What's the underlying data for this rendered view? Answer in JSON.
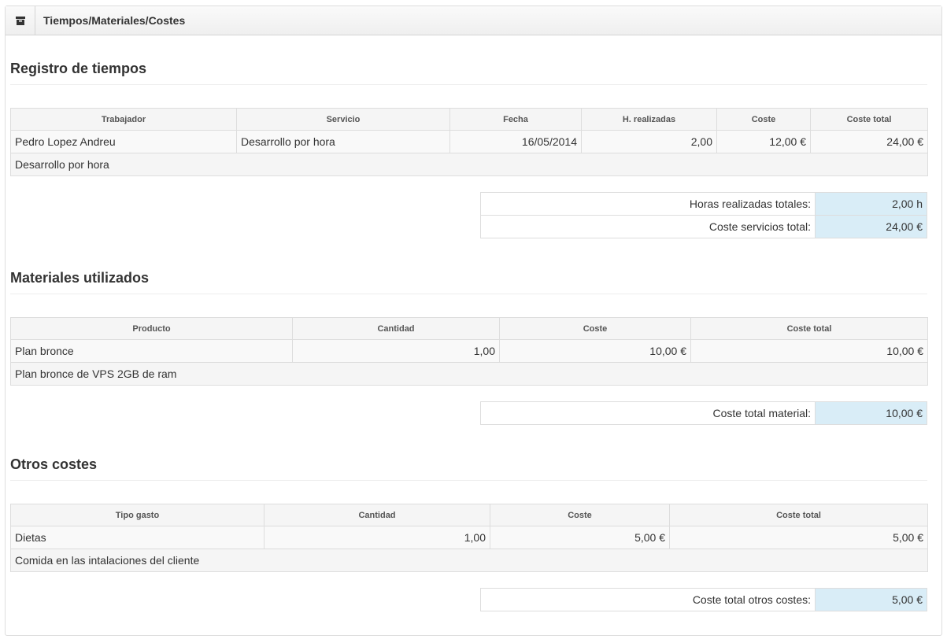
{
  "header": {
    "title": "Tiempos/Materiales/Costes",
    "icon": "archive-icon"
  },
  "time_section": {
    "title": "Registro de tiempos",
    "columns": [
      "Trabajador",
      "Servicio",
      "Fecha",
      "H. realizadas",
      "Coste",
      "Coste total"
    ],
    "row": {
      "worker": "Pedro Lopez Andreu",
      "service": "Desarrollo por hora",
      "date": "16/05/2014",
      "hours": "2,00",
      "cost": "12,00 €",
      "total": "24,00 €"
    },
    "description": "Desarrollo por hora",
    "summary": {
      "hours_label": "Horas realizadas totales:",
      "hours_value": "2,00 h",
      "cost_label": "Coste servicios total:",
      "cost_value": "24,00 €"
    }
  },
  "materials_section": {
    "title": "Materiales utilizados",
    "columns": [
      "Producto",
      "Cantidad",
      "Coste",
      "Coste total"
    ],
    "row": {
      "product": "Plan bronce",
      "quantity": "1,00",
      "cost": "10,00 €",
      "total": "10,00 €"
    },
    "description": "Plan bronce de VPS 2GB de ram",
    "summary": {
      "label": "Coste total material:",
      "value": "10,00 €"
    }
  },
  "other_section": {
    "title": "Otros costes",
    "columns": [
      "Tipo gasto",
      "Cantidad",
      "Coste",
      "Coste total"
    ],
    "row": {
      "type": "Dietas",
      "quantity": "1,00",
      "cost": "5,00 €",
      "total": "5,00 €"
    },
    "description": "Comida en las intalaciones del cliente",
    "summary": {
      "label": "Coste total otros costes:",
      "value": "5,00 €"
    }
  },
  "colors": {
    "summary_value_bg": "#d9edf7",
    "header_bg": "#f5f5f5",
    "border": "#dddddd"
  }
}
